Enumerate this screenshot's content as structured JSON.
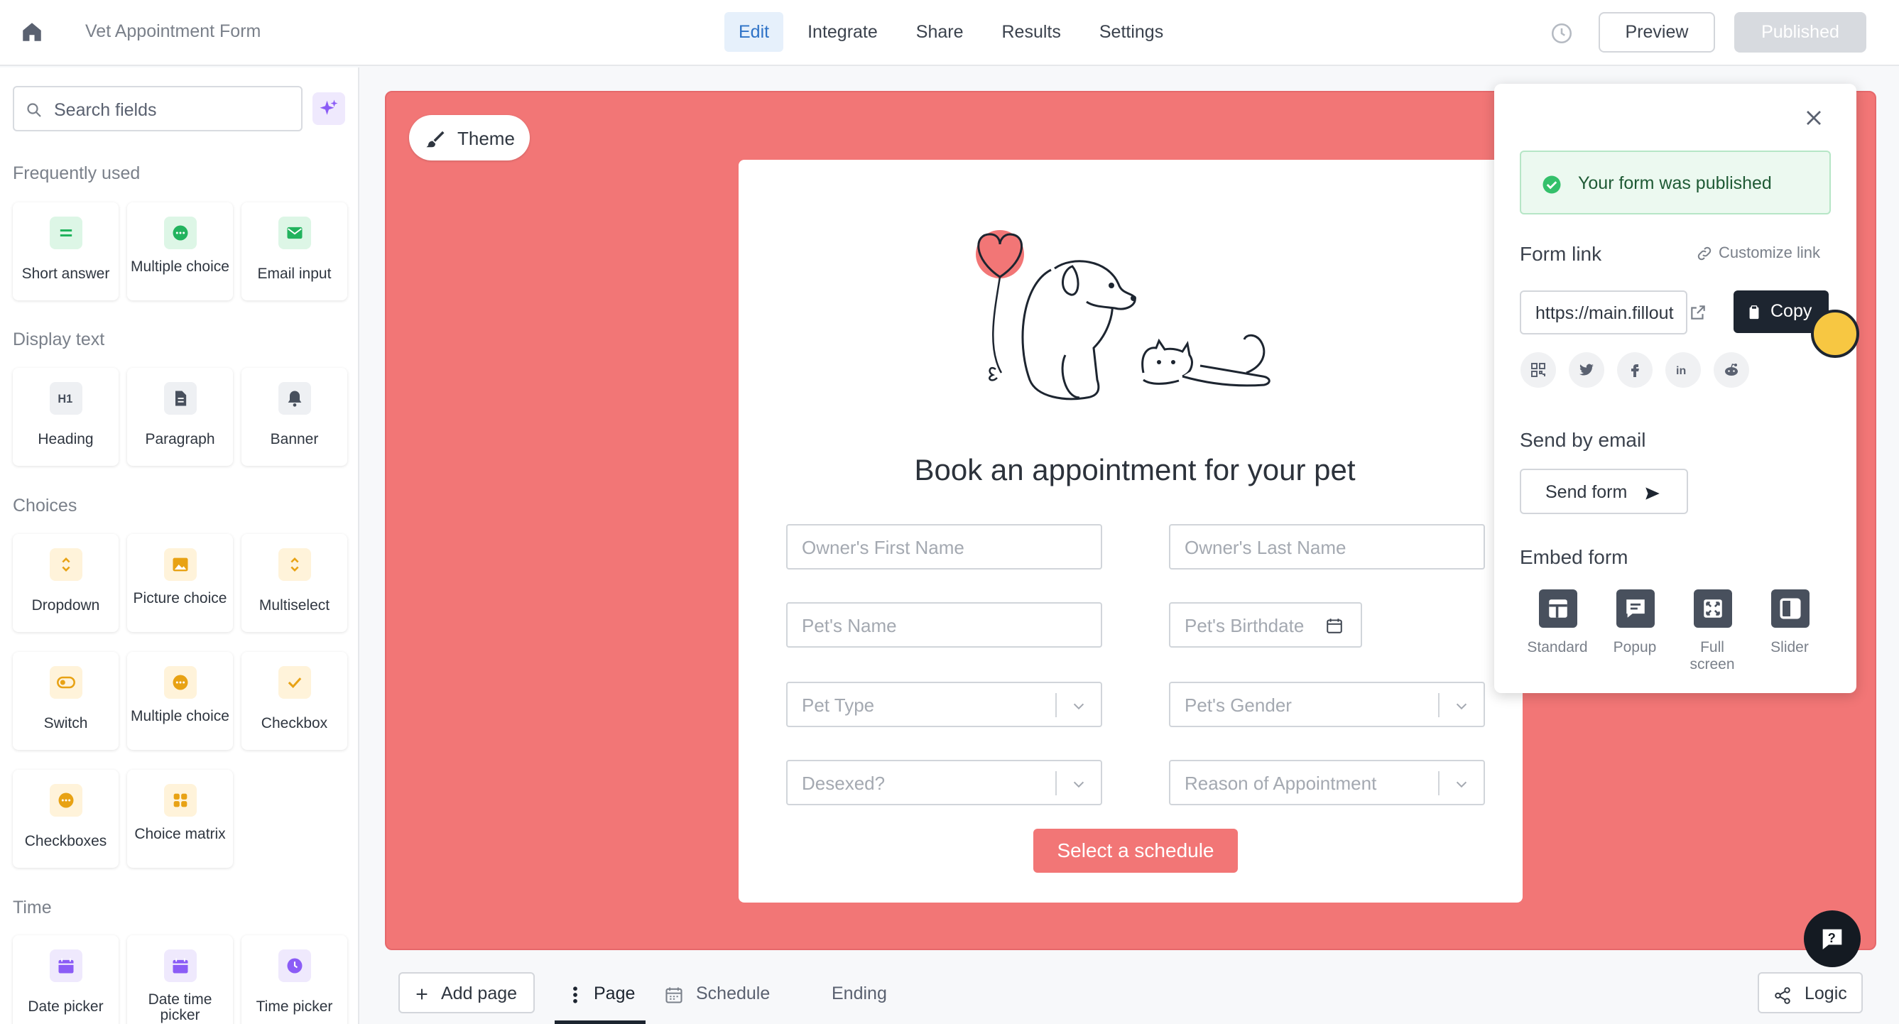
{
  "header": {
    "form_title": "Vet Appointment Form",
    "tabs": [
      {
        "label": "Edit",
        "active": true
      },
      {
        "label": "Integrate",
        "active": false
      },
      {
        "label": "Share",
        "active": false
      },
      {
        "label": "Results",
        "active": false
      },
      {
        "label": "Settings",
        "active": false
      }
    ],
    "preview_label": "Preview",
    "published_label": "Published"
  },
  "sidebar": {
    "search_placeholder": "Search fields",
    "sections": {
      "frequently_used": "Frequently used",
      "display_text": "Display text",
      "choices": "Choices",
      "time": "Time"
    },
    "fields": {
      "short_answer": "Short answer",
      "multiple_choice": "Multiple choice",
      "email_input": "Email input",
      "heading": "Heading",
      "paragraph": "Paragraph",
      "banner": "Banner",
      "dropdown": "Dropdown",
      "picture_choice": "Picture choice",
      "multiselect": "Multiselect",
      "switch": "Switch",
      "multiple_choice_2": "Multiple choice",
      "checkbox": "Checkbox",
      "checkboxes": "Checkboxes",
      "choice_matrix": "Choice matrix",
      "date_picker": "Date picker",
      "date_time_picker": "Date time picker",
      "time_picker": "Time picker"
    }
  },
  "canvas": {
    "theme_label": "Theme",
    "heading": "Book an appointment for your pet",
    "fields": {
      "owner_first": "Owner's First Name",
      "owner_last": "Owner's Last Name",
      "pet_name": "Pet's Name",
      "pet_birthdate": "Pet's Birthdate",
      "pet_type": "Pet Type",
      "pet_gender": "Pet's Gender",
      "desexed": "Desexed?",
      "reason": "Reason of Appointment"
    },
    "submit_label": "Select a schedule",
    "bg_color": "#f27676"
  },
  "share": {
    "published_message": "Your form was published",
    "form_link_heading": "Form link",
    "customize_link": "Customize link",
    "link_value": "https://main.fillout",
    "copy_label": "Copy",
    "send_email_heading": "Send by email",
    "send_form_label": "Send form",
    "embed_heading": "Embed form",
    "embed_options": [
      "Standard",
      "Popup",
      "Full screen",
      "Slider"
    ]
  },
  "footer": {
    "add_page_label": "Add page",
    "tabs": [
      {
        "label": "Page",
        "active": true
      },
      {
        "label": "Schedule",
        "active": false
      },
      {
        "label": "Ending",
        "active": false
      }
    ],
    "logic_label": "Logic"
  }
}
